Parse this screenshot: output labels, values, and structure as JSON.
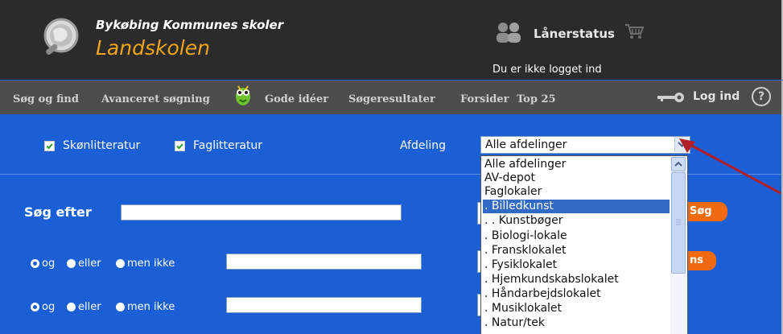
{
  "header": {
    "org_name": "Bykøbing Kommunes skoler",
    "school_name": "Landskolen",
    "status_title": "Lånerstatus",
    "login_status": "Du er ikke logget ind"
  },
  "nav": {
    "items": [
      "Søg og find",
      "Avanceret søgning",
      "Gode idéer",
      "Søgeresultater",
      "Forsider",
      "Top 25"
    ],
    "login": "Log ind",
    "help": "?"
  },
  "filters": {
    "fiction_label": "Skønlitteratur",
    "fiction_checked": true,
    "nonfiction_label": "Faglitteratur",
    "nonfiction_checked": true,
    "department_label": "Afdeling",
    "department_value": "Alle afdelinger"
  },
  "search": {
    "search_for_label": "Søg efter",
    "search_button": "Søg",
    "partial_button": "ns",
    "row_options": [
      "og",
      "eller",
      "men ikke"
    ]
  },
  "dropdown": {
    "options": [
      "Alle afdelinger",
      "AV-depot",
      "Faglokaler",
      ". Billedkunst",
      ". . Kunstbøger",
      ". Biologi-lokale",
      ". Fransklokalet",
      ". Fysiklokalet",
      ". Hjemkundskabslokalet",
      ". Håndarbejdslokalet",
      ". Musiklokalet",
      ". Natur/tek"
    ],
    "selected_index": 3
  },
  "colors": {
    "content_bg": "#1a5fd6",
    "header_bg": "#2b2b2b",
    "nav_bg": "#4d4d4d",
    "brand_orange": "#f2a516",
    "button_orange": "#f06a10",
    "selection_blue": "#316ac5",
    "arrow_red": "#b0202a"
  }
}
